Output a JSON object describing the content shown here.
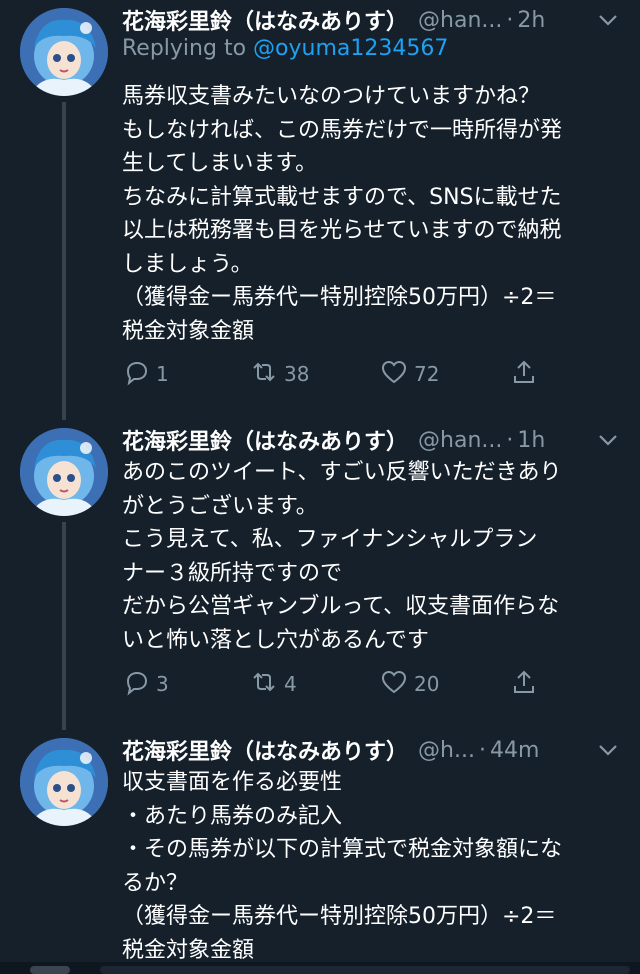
{
  "tweets": [
    {
      "name": "花海彩里鈴（はなみありす）",
      "handle": "@han...",
      "time": "2h",
      "reply_prefix": "Replying to ",
      "reply_to": "@oyuma1234567",
      "text": "馬券収支書みたいなのつけていますかね？\nもしなければ、この馬券だけで一時所得が発\n生してしまいます。\nちなみに計算式載せますので、SNSに載せた\n以上は税務署も目を光らせていますので納税\nしましょう。\n（獲得金ー馬券代ー特別控除50万円）÷2＝\n税金対象金額",
      "replies": "1",
      "retweets": "38",
      "likes": "72"
    },
    {
      "name": "花海彩里鈴（はなみありす）",
      "handle": "@han...",
      "time": "1h",
      "text": "あのこのツイート、すごい反響いただきあり\nがとうございます。\nこう見えて、私、ファイナンシャルプラン\nナー３級所持ですので\nだから公営ギャンブルって、収支書面作らな\nいと怖い落とし穴があるんです",
      "replies": "3",
      "retweets": "4",
      "likes": "20"
    },
    {
      "name": "花海彩里鈴（はなみありす）",
      "handle": "@h...",
      "time": "44m",
      "text": "収支書面を作る必要性\n・あたり馬券のみ記入\n・その馬券が以下の計算式で税金対象額にな\nるか？\n（獲得金ー馬券代ー特別控除50万円）÷2＝\n税金対象金額"
    }
  ],
  "separator": "·",
  "icons": {
    "reply": "reply-icon",
    "retweet": "retweet-icon",
    "like": "heart-icon",
    "share": "share-icon",
    "menu": "chevron-down-icon"
  },
  "colors": {
    "background": "#15202b",
    "secondary_text": "#8899a6",
    "link": "#1da1f2",
    "thread_line": "#38444d"
  }
}
